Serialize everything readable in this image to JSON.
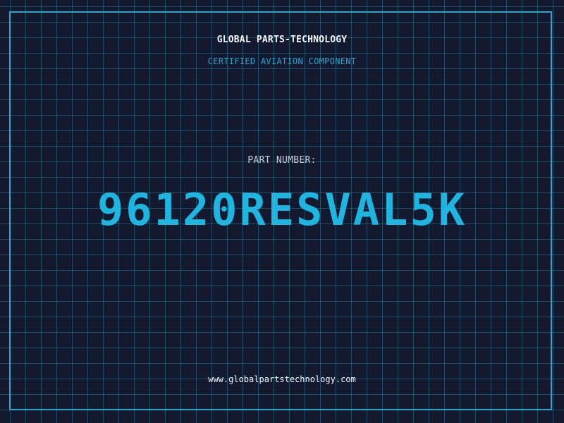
{
  "header": {
    "company_name": "GLOBAL PARTS-TECHNOLOGY",
    "tagline": "CERTIFIED AVIATION COMPONENT"
  },
  "part": {
    "label": "PART NUMBER:",
    "number": "96120RESVAL5K"
  },
  "footer": {
    "website": "www.globalpartstechnology.com"
  },
  "colors": {
    "background": "#131a30",
    "accent": "#2aa6cf",
    "part_number": "#1eb6e1",
    "text": "#f2f4f7"
  }
}
